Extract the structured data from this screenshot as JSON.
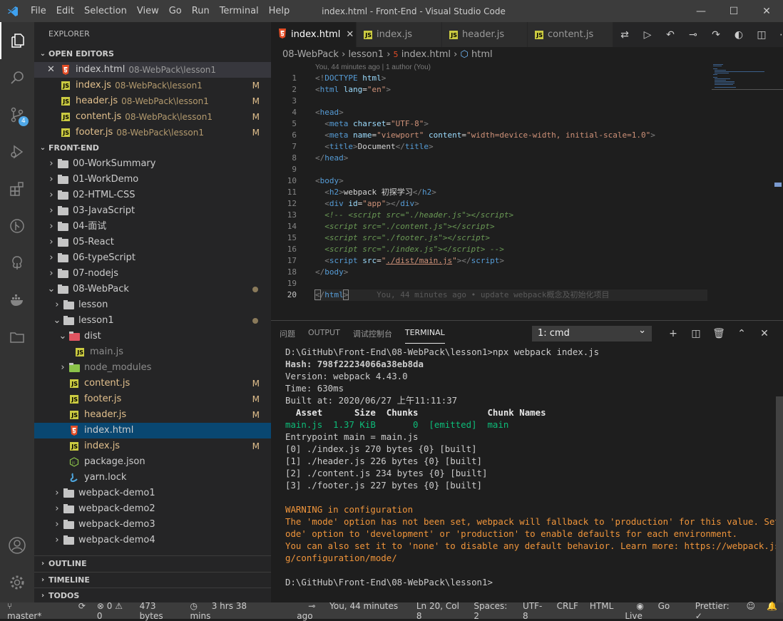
{
  "window": {
    "title": "index.html - Front-End - Visual Studio Code"
  },
  "menu": [
    "File",
    "Edit",
    "Selection",
    "View",
    "Go",
    "Run",
    "Terminal",
    "Help"
  ],
  "explorer": {
    "title": "EXPLORER",
    "open_editors_label": "OPEN EDITORS",
    "open_editors": [
      {
        "name": "index.html",
        "path": "08-WebPack\\lesson1",
        "type": "html",
        "mod": ""
      },
      {
        "name": "index.js",
        "path": "08-WebPack\\lesson1",
        "type": "js",
        "mod": "M"
      },
      {
        "name": "header.js",
        "path": "08-WebPack\\lesson1",
        "type": "js",
        "mod": "M"
      },
      {
        "name": "content.js",
        "path": "08-WebPack\\lesson1",
        "type": "js",
        "mod": "M"
      },
      {
        "name": "footer.js",
        "path": "08-WebPack\\lesson1",
        "type": "js",
        "mod": "M"
      }
    ],
    "workspace_label": "FRONT-END",
    "tree": [
      {
        "name": "00-WorkSummary",
        "kind": "folder",
        "depth": 0,
        "open": false
      },
      {
        "name": "01-WorkDemo",
        "kind": "folder",
        "depth": 0,
        "open": false
      },
      {
        "name": "02-HTML-CSS",
        "kind": "folder",
        "depth": 0,
        "open": false
      },
      {
        "name": "03-JavaScript",
        "kind": "folder",
        "depth": 0,
        "open": false
      },
      {
        "name": "04-面试",
        "kind": "folder",
        "depth": 0,
        "open": false
      },
      {
        "name": "05-React",
        "kind": "folder",
        "depth": 0,
        "open": false
      },
      {
        "name": "06-typeScript",
        "kind": "folder",
        "depth": 0,
        "open": false
      },
      {
        "name": "07-nodejs",
        "kind": "folder",
        "depth": 0,
        "open": false
      },
      {
        "name": "08-WebPack",
        "kind": "folder",
        "depth": 0,
        "open": true,
        "dot": true
      },
      {
        "name": "lesson",
        "kind": "folder",
        "depth": 1,
        "open": false
      },
      {
        "name": "lesson1",
        "kind": "folder",
        "depth": 1,
        "open": true,
        "dot": true
      },
      {
        "name": "dist",
        "kind": "dist",
        "depth": 2,
        "open": true
      },
      {
        "name": "main.js",
        "kind": "js",
        "depth": 3
      },
      {
        "name": "node_modules",
        "kind": "nm",
        "depth": 2,
        "open": false
      },
      {
        "name": "content.js",
        "kind": "js",
        "depth": 2,
        "mod": "M"
      },
      {
        "name": "footer.js",
        "kind": "js",
        "depth": 2,
        "mod": "M"
      },
      {
        "name": "header.js",
        "kind": "js",
        "depth": 2,
        "mod": "M"
      },
      {
        "name": "index.html",
        "kind": "html",
        "depth": 2,
        "focus": true
      },
      {
        "name": "index.js",
        "kind": "js",
        "depth": 2,
        "mod": "M"
      },
      {
        "name": "package.json",
        "kind": "json",
        "depth": 2
      },
      {
        "name": "yarn.lock",
        "kind": "yarn",
        "depth": 2
      },
      {
        "name": "webpack-demo1",
        "kind": "folder",
        "depth": 1,
        "open": false
      },
      {
        "name": "webpack-demo2",
        "kind": "folder",
        "depth": 1,
        "open": false
      },
      {
        "name": "webpack-demo3",
        "kind": "folder",
        "depth": 1,
        "open": false
      },
      {
        "name": "webpack-demo4",
        "kind": "folder",
        "depth": 1,
        "open": false
      }
    ],
    "outline_label": "OUTLINE",
    "timeline_label": "TIMELINE",
    "todos_label": "TODOS"
  },
  "tabs": [
    {
      "label": "index.html",
      "type": "html",
      "active": true
    },
    {
      "label": "index.js",
      "type": "js"
    },
    {
      "label": "header.js",
      "type": "js"
    },
    {
      "label": "content.js",
      "type": "js"
    }
  ],
  "breadcrumb": [
    "08-WebPack",
    "lesson1",
    "index.html",
    "html"
  ],
  "blame_header": "You, 44 minutes ago | 1 author (You)",
  "inline_blame": "You, 44 minutes ago • update webpack概念及初始化项目",
  "code_lines": [
    "1",
    "2",
    "3",
    "4",
    "5",
    "6",
    "7",
    "8",
    "9",
    "10",
    "11",
    "12",
    "13",
    "14",
    "15",
    "16",
    "17",
    "18",
    "19",
    "20"
  ],
  "panel": {
    "tabs": [
      "问题",
      "OUTPUT",
      "调试控制台",
      "TERMINAL"
    ],
    "active_tab": "TERMINAL",
    "terminal_select": "1: cmd",
    "lines": [
      "D:\\GitHub\\Front-End\\08-WebPack\\lesson1>npx webpack index.js",
      "Hash: 798f22234066a38eb8da",
      "Version: webpack 4.43.0",
      "Time: 630ms",
      "Built at: 2020/06/27 上午11:11:37",
      "  Asset      Size  Chunks             Chunk Names",
      "main.js  1.37 KiB       0  [emitted]  main",
      "Entrypoint main = main.js",
      "[0] ./index.js 270 bytes {0} [built]",
      "[1] ./header.js 226 bytes {0} [built]",
      "[2] ./content.js 234 bytes {0} [built]",
      "[3] ./footer.js 227 bytes {0} [built]",
      "",
      "WARNING in configuration",
      "The 'mode' option has not been set, webpack will fallback to 'production' for this value. Set 'm",
      "ode' option to 'development' or 'production' to enable defaults for each environment.",
      "You can also set it to 'none' to disable any default behavior. Learn more: https://webpack.js.or",
      "g/configuration/mode/",
      "",
      "D:\\GitHub\\Front-End\\08-WebPack\\lesson1>"
    ]
  },
  "status": {
    "branch": "master*",
    "problems": "⊗ 0 ⚠ 0",
    "size": "473 bytes",
    "time": "3 hrs 38 mins",
    "blame": "You, 44 minutes ago",
    "position": "Ln 20, Col 8",
    "spaces": "Spaces: 2",
    "encoding": "UTF-8",
    "eol": "CRLF",
    "lang": "HTML",
    "golive": "Go Live",
    "prettier": "Prettier: ✓"
  }
}
